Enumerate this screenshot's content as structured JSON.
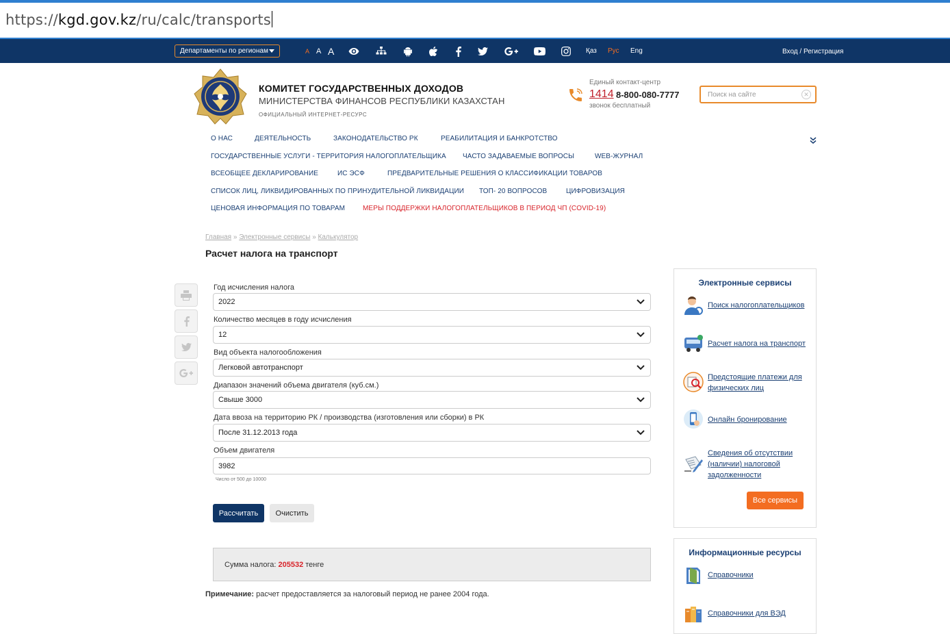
{
  "browser": {
    "url_prefix": "https://",
    "url_host": "kgd.gov.kz",
    "url_path": "/ru/calc/transports"
  },
  "topbar": {
    "departments_label": "Департаменты по регионам",
    "font_small": "A",
    "font_medium": "A",
    "font_large": "A",
    "langs": [
      "Қаз",
      "Рус",
      "Eng"
    ],
    "active_lang": "Рус",
    "login_label": "Вход / Регистрация"
  },
  "header": {
    "org_title": "КОМИТЕТ ГОСУДАРСТВЕННЫХ ДОХОДОВ",
    "org_subtitle": "МИНИСТЕРСТВА ФИНАНСОВ РЕСПУБЛИКИ КАЗАХСТАН",
    "org_note": "ОФИЦИАЛЬНЫЙ ИНТЕРНЕТ-РЕСУРС",
    "contact_label": "Единый контакт-центр",
    "contact_short": "1414",
    "contact_long": "8-800-080-7777",
    "contact_free": "звонок бесплатный",
    "search_placeholder": "Поиск на сайте"
  },
  "menu": {
    "items": [
      "О НАС",
      "ДЕЯТЕЛЬНОСТЬ",
      "ЗАКОНОДАТЕЛЬСТВО РК",
      "РЕАБИЛИТАЦИЯ И БАНКРОТСТВО",
      "ГОСУДАРСТВЕННЫЕ УСЛУГИ - ТЕРРИТОРИЯ НАЛОГОПЛАТЕЛЬЩИКА",
      "ЧАСТО ЗАДАВАЕМЫЕ ВОПРОСЫ",
      "WEB-ЖУРНАЛ",
      "ВСЕОБЩЕЕ ДЕКЛАРИРОВАНИЕ",
      "ИС ЭСФ",
      "ПРЕДВАРИТЕЛЬНЫЕ РЕШЕНИЯ О КЛАССИФИКАЦИИ ТОВАРОВ",
      "СПИСОК ЛИЦ, ЛИКВИДИРОВАННЫХ ПО ПРИНУДИТЕЛЬНОЙ ЛИКВИДАЦИИ",
      "ТОП- 20 ВОПРОСОВ",
      "ЦИФРОВИЗАЦИЯ",
      "ЦЕНОВАЯ ИНФОРМАЦИЯ ПО ТОВАРАМ",
      "МЕРЫ ПОДДЕРЖКИ НАЛОГОПЛАТЕЛЬЩИКОВ В ПЕРИОД ЧП (COVID-19)"
    ],
    "highlight_color": "#d8232a"
  },
  "breadcrumb": {
    "items": [
      "Главная",
      "Электронные сервисы",
      "Калькулятор"
    ],
    "separator": "»"
  },
  "page_title": "Расчет налога на транспорт",
  "form": {
    "fields": [
      {
        "label": "Год исчисления налога",
        "value": "2022"
      },
      {
        "label": "Количество месяцев в году исчисления",
        "value": "12"
      },
      {
        "label": "Вид объекта налогообложения",
        "value": "Легковой автотранспорт"
      },
      {
        "label": "Диапазон значений объема двигателя (куб.см.)",
        "value": "Свыше 3000"
      },
      {
        "label": "Дата ввоза на территорию РК / производства (изготовления или сборки) в РК",
        "value": "После 31.12.2013 года"
      }
    ],
    "engine_label": "Объем двигателя",
    "engine_value": "3982",
    "engine_hint": "Число от 500 до 10000",
    "calc_label": "Рассчитать",
    "clear_label": "Очистить"
  },
  "result": {
    "label": "Сумма налога:",
    "value": "205532",
    "unit": "тенге"
  },
  "note": {
    "label": "Примечание:",
    "text": "расчет предоставляется за налоговый период не ранее 2004 года."
  },
  "services": {
    "title": "Электронные сервисы",
    "items": [
      {
        "label": "Поиск налогоплательщиков",
        "icon": "person-search-icon"
      },
      {
        "label": "Расчет налога на транспорт",
        "icon": "bus-icon"
      },
      {
        "label": "Предстоящие платежи для физических лиц",
        "icon": "payments-search-icon"
      },
      {
        "label": "Онлайн бронирование",
        "icon": "phone-booking-icon"
      },
      {
        "label": "Сведения об отсутствии (наличии) налоговой задолженности",
        "icon": "debt-info-icon"
      }
    ],
    "all_label": "Все сервисы"
  },
  "resources": {
    "title": "Информационные ресурсы",
    "items": [
      {
        "label": "Справочники",
        "icon": "book-icon"
      },
      {
        "label": "Справочники для ВЭД",
        "icon": "books-icon"
      }
    ]
  },
  "colors": {
    "navy": "#0f3566",
    "accent": "#f36d21",
    "link": "#1a3f73",
    "red": "#d8232a"
  }
}
